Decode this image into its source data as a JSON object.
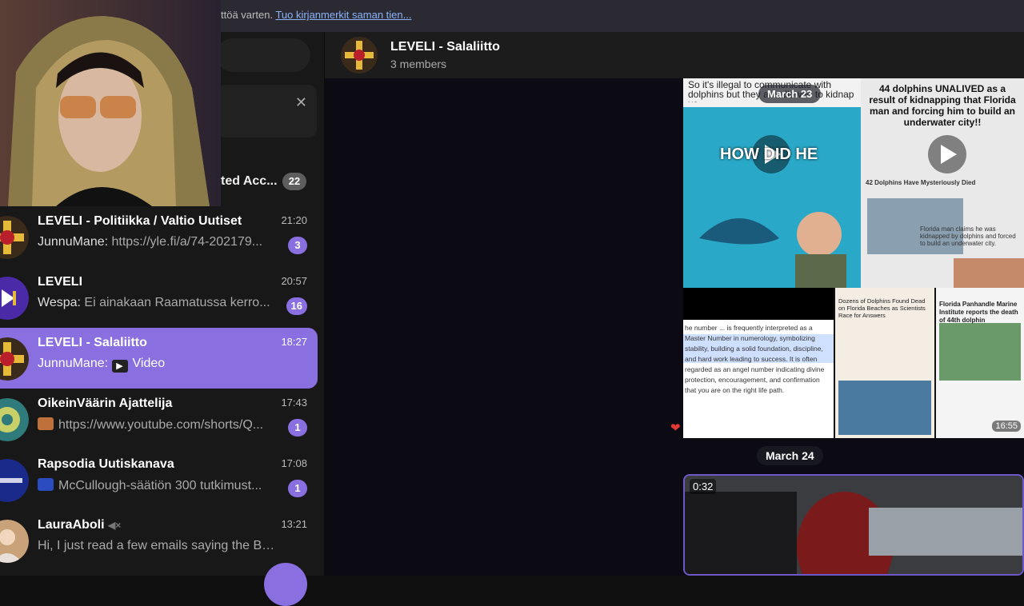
{
  "bookmarks_bar": {
    "text": "ttöä varten.",
    "link": "Tuo kirjanmerkit saman tien..."
  },
  "sidebar": {
    "archive_label": "ted Acc...",
    "archive_count": "22",
    "chats": [
      {
        "name": "LEVELI - Politiikka / Valtio Uutiset",
        "time": "21:20",
        "sender": "JunnuMane:",
        "text": "https://yle.fi/a/74-202179...",
        "badge": "3"
      },
      {
        "name": "LEVELI",
        "time": "20:57",
        "sender": "Wespa:",
        "text": "Ei ainakaan Raamatussa kerro...",
        "badge": "16"
      },
      {
        "name": "LEVELI - Salaliitto",
        "time": "18:27",
        "sender": "JunnuMane:",
        "text": "Video",
        "badge": ""
      },
      {
        "name": "OikeinVäärin Ajattelija",
        "time": "17:43",
        "sender": "",
        "text": "https://www.youtube.com/shorts/Q...",
        "badge": "1"
      },
      {
        "name": "Rapsodia Uutiskanava",
        "time": "17:08",
        "sender": "",
        "text": "McCullough-säätiön 300 tutkimust...",
        "badge": "1"
      },
      {
        "name": "LauraAboli",
        "time": "13:21",
        "sender": "",
        "text": "Hi, I just read a few emails saying the BIBI F...",
        "badge": ""
      }
    ]
  },
  "header": {
    "title": "LEVELI - Salaliitto",
    "subtitle": "3 members"
  },
  "messages": {
    "date1": "March 23",
    "date2": "March 24",
    "tiktok_caption": "So it's illegal to communicate with dolphins but they are allowed to kidnap us...",
    "tiktok_text": "HOW DID HE",
    "dolphin_caption": "44 dolphins UNALIVED as a result of kidnapping that Florida man and forcing him to build an underwater city!!",
    "dolphin_sub": "42 Dolphins Have Mysteriously Died",
    "florida_caption": "Florida man claims he was kidnapped by dolphins and forced to build an underwater city.",
    "numerology_text": "he number ... is frequently interpreted as a Master Number in numerology, symbolizing stability, building a solid foundation, discipline, and hard work leading to success. It is often regarded as an angel number indicating divine protection, encouragement, and confirmation that you are on the right life path.",
    "news1": "Dozens of Dolphins Found Dead on Florida Beaches as Scientists Race for Answers",
    "news2": "Florida Panhandle Marine Institute reports the death of 44th dolphin",
    "album_time": "16:55",
    "video_duration": "0:32"
  }
}
